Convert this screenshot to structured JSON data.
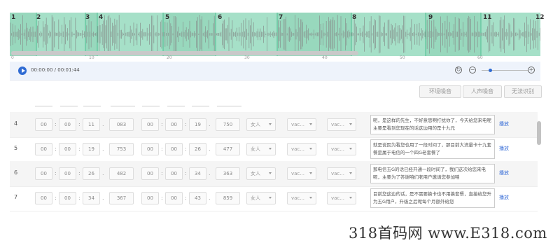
{
  "waveform": {
    "segment_numbers": [
      "1",
      "2",
      "3",
      "4",
      "5",
      "6",
      "7",
      "8",
      "9",
      "11",
      "12"
    ],
    "ruler_ticks": [
      "0",
      "10",
      "20",
      "30",
      "40",
      "50",
      "60"
    ]
  },
  "player": {
    "time": "00:00:00 / 00:01:44"
  },
  "actions": {
    "ambient": "环境噪音",
    "voice": "人声噪音",
    "unrecognizable": "无法识别"
  },
  "rows": [
    {
      "index": "4",
      "start": [
        "00",
        "00",
        "11",
        "083"
      ],
      "end": [
        "00",
        "00",
        "19",
        "750"
      ],
      "gender": "女人",
      "v1": "vac...",
      "v2": "vac...",
      "text": "呃，是这样的先生，不好意思啊打扰你了，今天给您来电呢主要是看到您现在的话这边用的是十九元",
      "action": "播放"
    },
    {
      "index": "5",
      "start": [
        "00",
        "00",
        "19",
        "753"
      ],
      "end": [
        "00",
        "00",
        "26",
        "477"
      ],
      "gender": "女人",
      "v1": "vac...",
      "v2": "vac...",
      "text": "就是说因为看您也用了一段时间了，那目前大流量卡十九套餐是属于电信的一个四G老套餐了",
      "action": "播放"
    },
    {
      "index": "6",
      "start": [
        "00",
        "00",
        "26",
        "482"
      ],
      "end": [
        "00",
        "00",
        "34",
        "363"
      ],
      "gender": "女人",
      "v1": "vac...",
      "v2": "vac...",
      "text": "那电信五G的话已经开通一段时间了，我们这次给您来电呢，主要为了答谢咱们老用户邀请您参加咱",
      "action": "播放"
    },
    {
      "index": "7",
      "start": [
        "00",
        "00",
        "34",
        "367"
      ],
      "end": [
        "00",
        "00",
        "43",
        "859"
      ],
      "gender": "女人",
      "v1": "vac...",
      "v2": "vac...",
      "text": "目前您这边的话，是不需要换卡也不用换套餐，直接给您升为五G用户，升级之后呢每个月额外给您",
      "action": "播放"
    }
  ],
  "watermark": "318首码网 www.E318.com"
}
